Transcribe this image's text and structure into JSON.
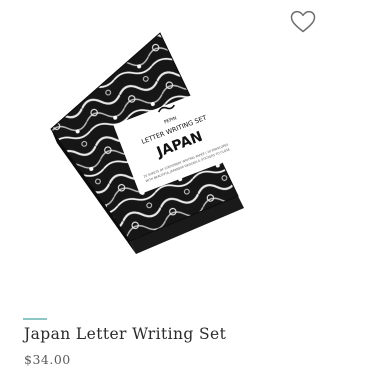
{
  "product": {
    "title": "Japan Letter Writing Set",
    "price": "$34.00",
    "wishlist_icon": "heart-outline-icon",
    "image": {
      "subject": "product-box",
      "brand": "PEPIN",
      "label_line": "LETTER WRITING SET",
      "label_title": "JAPAN",
      "small_print_1": "20 SHEETS OF STATIONERY WRITING PAPER | 20 ENVELOPES",
      "small_print_2": "WITH BEAUTIFUL JAPANESE DESIGNS & STICKERS TO CLOSE"
    }
  },
  "colors": {
    "accent": "#8cc7c6",
    "title": "#2b2b2b",
    "price": "#5b5b5b"
  }
}
